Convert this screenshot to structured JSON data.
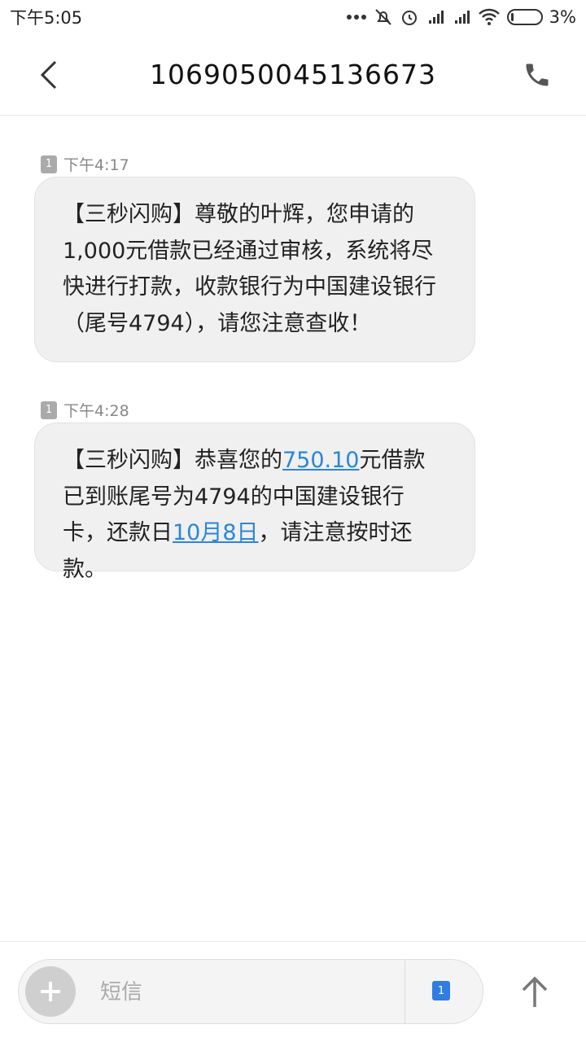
{
  "status_bar": {
    "time": "下午5:05",
    "battery": "3%"
  },
  "header": {
    "title": "1069050045136673"
  },
  "messages": [
    {
      "sim": "1",
      "time": "下午4:17",
      "text": "【三秒闪购】尊敬的叶辉，您申请的1,000元借款已经通过审核，系统将尽快进行打款，收款银行为中国建设银行（尾号4794），请您注意查收！"
    },
    {
      "sim": "1",
      "time": "下午4:28",
      "text_a": "【三秒闪购】恭喜您的",
      "link_amount": "750.10",
      "text_b": "元借款已到账尾号为4794的中国建设银行卡，还款日",
      "link_date": "10月8日",
      "text_c": "，请注意按时还款。"
    }
  ],
  "composer": {
    "placeholder": "短信",
    "sim": "1"
  },
  "colors": {
    "link": "#2a86d8",
    "sim_selected": "#2f7de0"
  }
}
